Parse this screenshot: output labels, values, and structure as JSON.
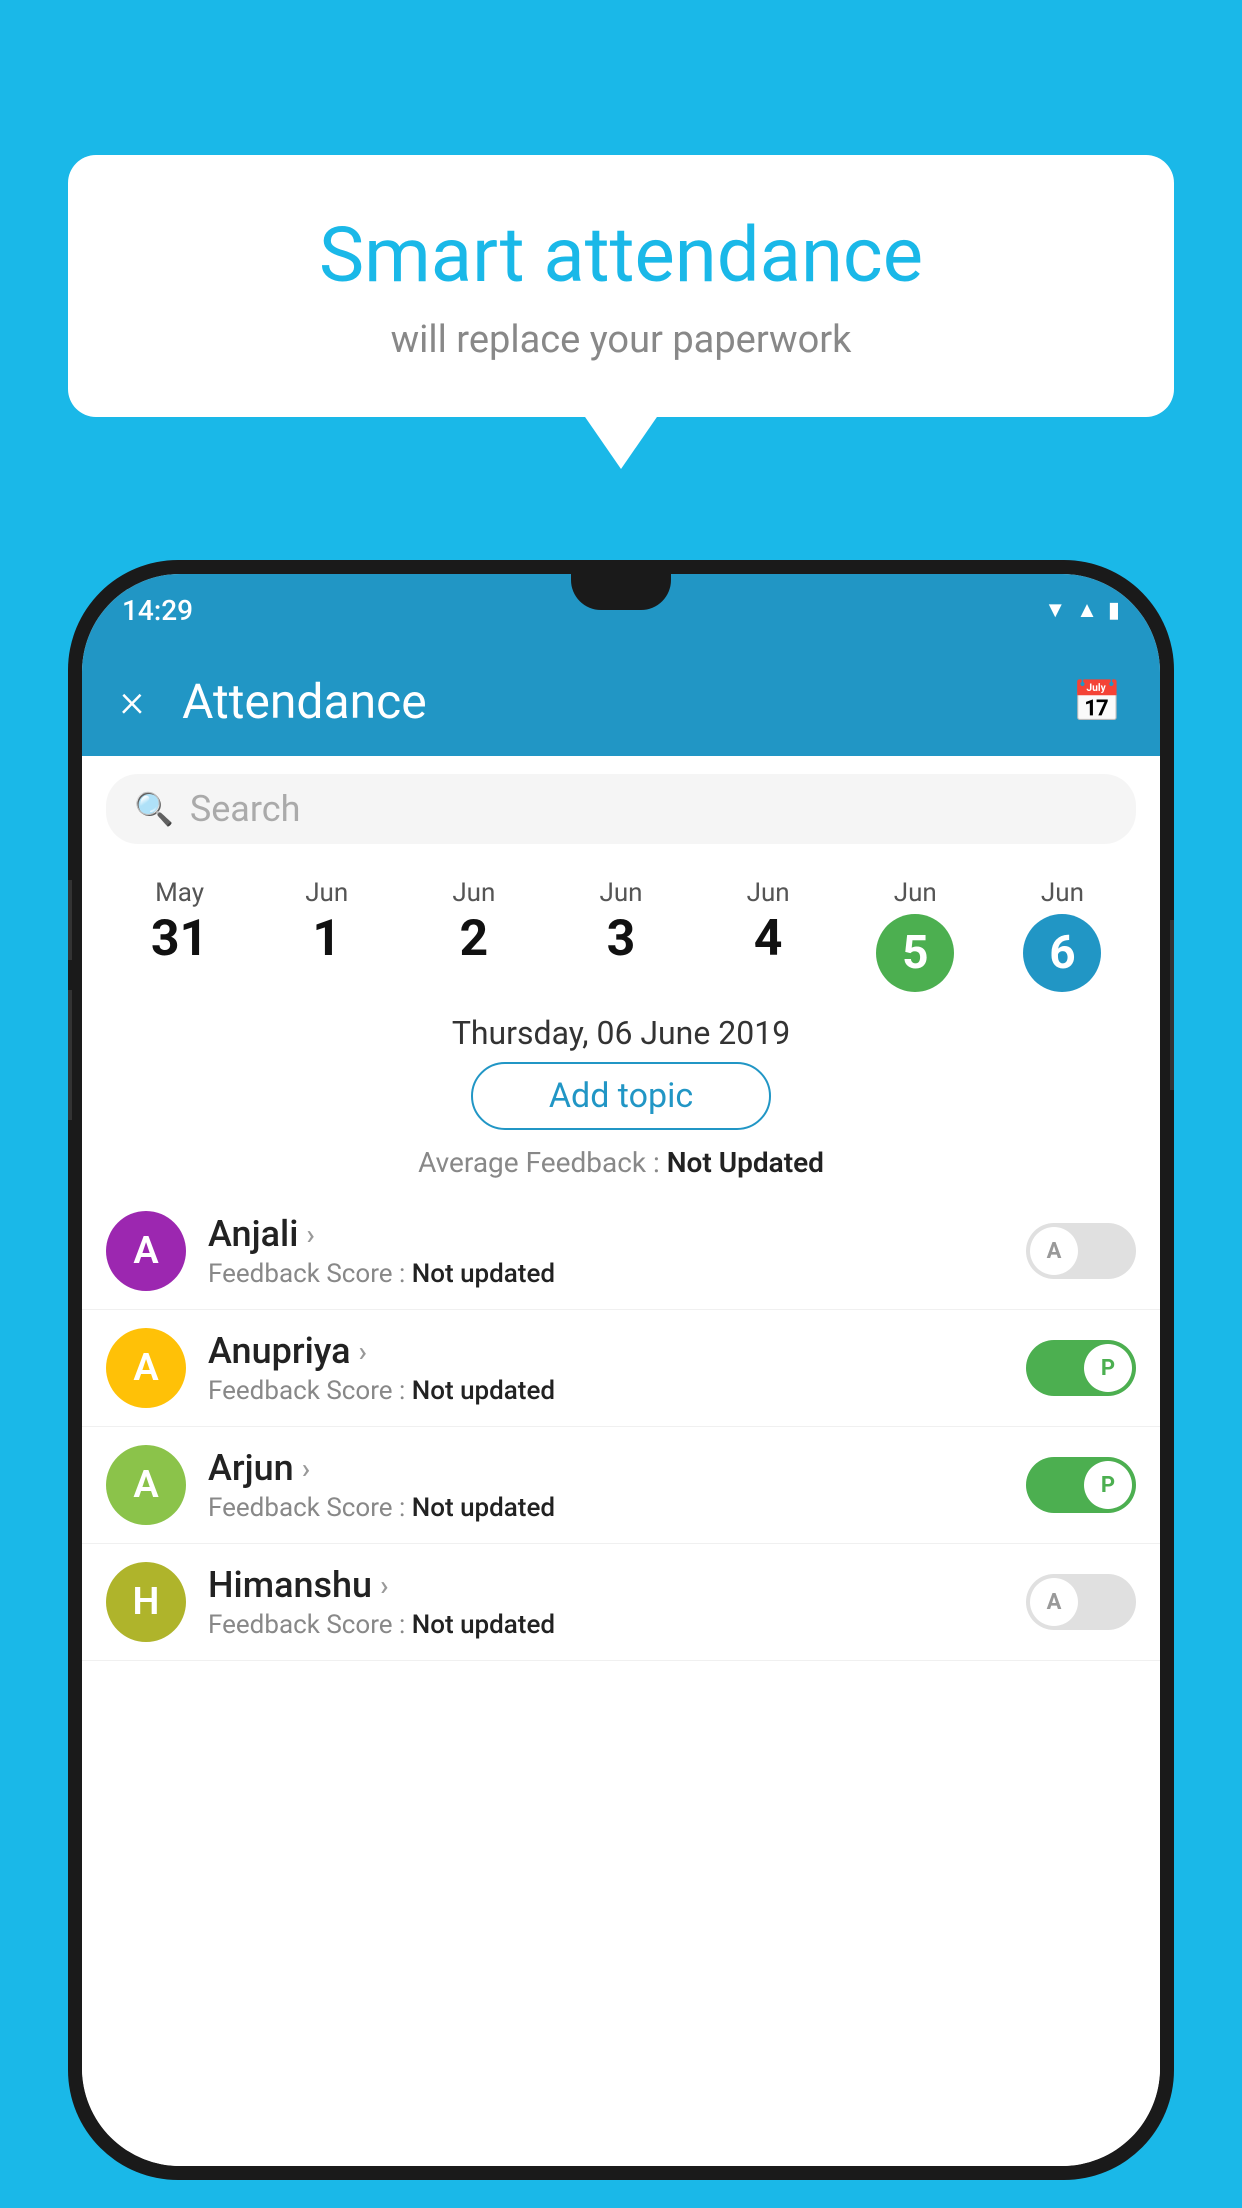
{
  "background_color": "#1AB8E8",
  "bubble": {
    "title": "Smart attendance",
    "subtitle": "will replace your paperwork"
  },
  "status_bar": {
    "time": "14:29",
    "icons": [
      "wifi",
      "signal",
      "battery"
    ]
  },
  "app_bar": {
    "title": "Attendance",
    "close_label": "×",
    "calendar_label": "📅"
  },
  "search": {
    "placeholder": "Search"
  },
  "calendar": {
    "days": [
      {
        "month": "May",
        "date": "31",
        "selected": false
      },
      {
        "month": "Jun",
        "date": "1",
        "selected": false
      },
      {
        "month": "Jun",
        "date": "2",
        "selected": false
      },
      {
        "month": "Jun",
        "date": "3",
        "selected": false
      },
      {
        "month": "Jun",
        "date": "4",
        "selected": false
      },
      {
        "month": "Jun",
        "date": "5",
        "selected": "green"
      },
      {
        "month": "Jun",
        "date": "6",
        "selected": "blue"
      }
    ]
  },
  "selected_date_label": "Thursday, 06 June 2019",
  "add_topic_label": "Add topic",
  "avg_feedback_label": "Average Feedback :",
  "avg_feedback_value": "Not Updated",
  "students": [
    {
      "name": "Anjali",
      "avatar_letter": "A",
      "avatar_color": "av-purple",
      "feedback_label": "Feedback Score :",
      "feedback_value": "Not updated",
      "toggle": "off",
      "toggle_letter": "A"
    },
    {
      "name": "Anupriya",
      "avatar_letter": "A",
      "avatar_color": "av-yellow",
      "feedback_label": "Feedback Score :",
      "feedback_value": "Not updated",
      "toggle": "on",
      "toggle_letter": "P"
    },
    {
      "name": "Arjun",
      "avatar_letter": "A",
      "avatar_color": "av-lightgreen",
      "feedback_label": "Feedback Score :",
      "feedback_value": "Not updated",
      "toggle": "on",
      "toggle_letter": "P"
    },
    {
      "name": "Himanshu",
      "avatar_letter": "H",
      "avatar_color": "av-khaki",
      "feedback_label": "Feedback Score :",
      "feedback_value": "Not updated",
      "toggle": "off",
      "toggle_letter": "A"
    }
  ]
}
